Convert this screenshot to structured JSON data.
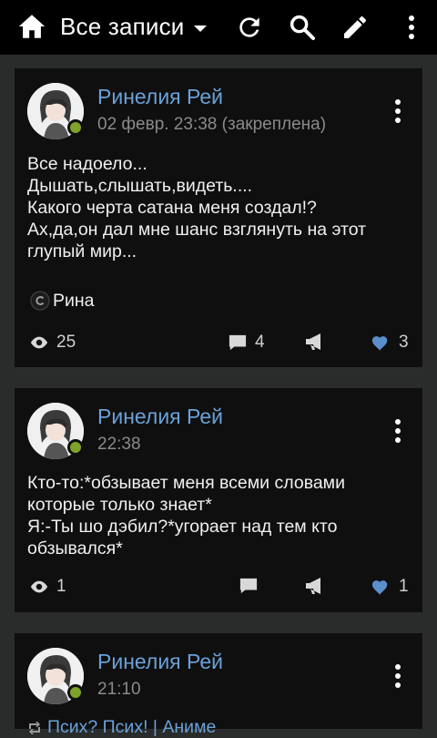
{
  "header": {
    "title": "Все записи"
  },
  "posts": [
    {
      "author": "Ринелия Рей",
      "date": "02 февр. 23:38 (закреплена)",
      "text": "Все надоело...\nДышать,слышать,видеть....\nКакого черта  сатана меня создал!?\nАх,да,он дал мне шанс взглянуть на этот\nглупый мир...",
      "signature": "Рина",
      "views": "25",
      "comments": "4",
      "likes": "3"
    },
    {
      "author": "Ринелия Рей",
      "date": "22:38",
      "text": "Кто-то:*обзывает меня всеми словами\nкоторые только знает*\nЯ:-Ты шо дэбил?*угорает над тем кто\nобзывался*",
      "views": "1",
      "likes": "1"
    },
    {
      "author": "Ринелия Рей",
      "date": "21:10",
      "repost": "Псих? Псих! | Аниме"
    }
  ],
  "colors": {
    "accent": "#6aa1d8",
    "online": "#7fa32a",
    "card": "#0f0f0f",
    "background": "#2a2c2b",
    "like": "#5b8fcc"
  }
}
